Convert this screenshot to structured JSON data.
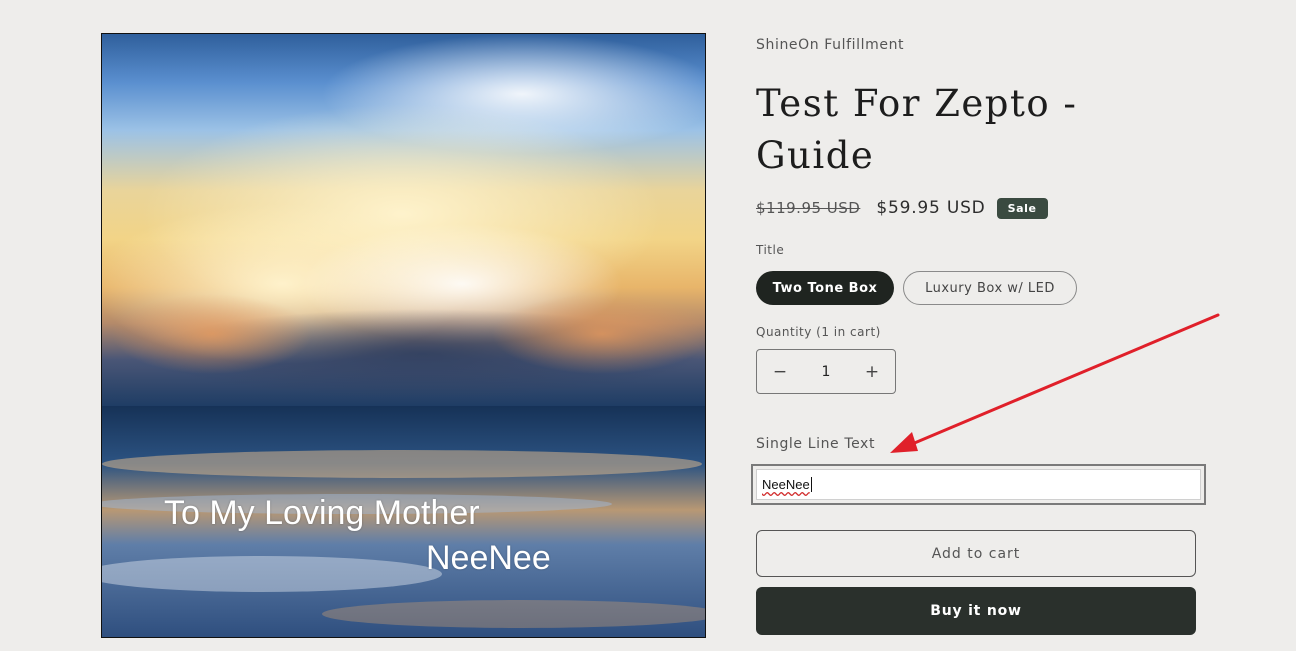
{
  "product": {
    "vendor": "ShineOn Fulfillment",
    "title": "Test For Zepto - Guide",
    "price_regular": "$119.95 USD",
    "price_sale": "$59.95 USD",
    "sale_badge": "Sale",
    "image_text_line1": "To My Loving Mother",
    "image_text_line2": "NeeNee"
  },
  "options": {
    "label": "Title",
    "values": [
      "Two Tone Box",
      "Luxury Box w/ LED"
    ],
    "selected": "Two Tone Box"
  },
  "quantity": {
    "label": "Quantity (1 in cart)",
    "value": "1",
    "minus_symbol": "−",
    "plus_symbol": "+"
  },
  "custom_text": {
    "label": "Single Line Text",
    "value": "NeeNee"
  },
  "actions": {
    "add_to_cart": "Add to cart",
    "buy_now": "Buy it now"
  },
  "colors": {
    "background": "#eeedeb",
    "dark_button": "#2a302c",
    "sale_badge": "#3a4a40",
    "annotation_arrow": "#e0202a"
  }
}
